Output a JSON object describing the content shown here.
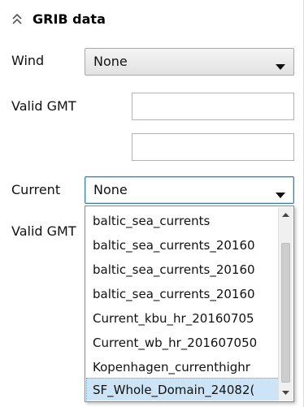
{
  "header": {
    "title": "GRIB data",
    "collapse_icon": "chevron-double-up-icon"
  },
  "wind": {
    "label": "Wind",
    "value": "None"
  },
  "wind_valid": {
    "label": "Valid GMT",
    "value_1": "",
    "value_2": ""
  },
  "current": {
    "label": "Current",
    "value": "None"
  },
  "current_valid": {
    "label": "Valid GMT"
  },
  "dropdown": {
    "items": [
      "baltic_sea_currents",
      "baltic_sea_currents_20160",
      "baltic_sea_currents_20160",
      "baltic_sea_currents_20160",
      "Current_kbu_hr_20160705",
      "Current_wb_hr_201607050",
      "Kopenhagen_currenthighr",
      "SF_Whole_Domain_24082("
    ],
    "selected_index": 7
  },
  "colors": {
    "accent_border": "#3c7fb1",
    "selection_bg": "#cde4f7"
  }
}
